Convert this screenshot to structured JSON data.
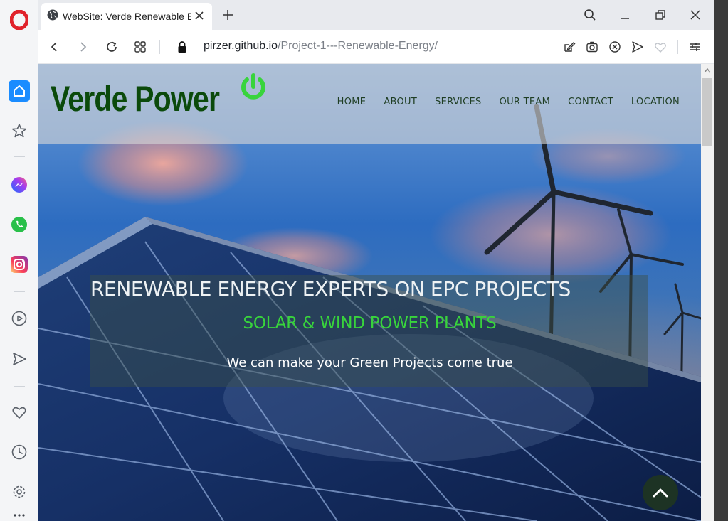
{
  "browser": {
    "tab_title": "WebSite: Verde Renewable Energy",
    "url_host": "pirzer.github.io",
    "url_path": "/Project-1---Renewable-Energy/"
  },
  "sidebar": {
    "items": [
      "opera-logo",
      "home-icon",
      "star-icon",
      "messenger-icon",
      "whatsapp-icon",
      "instagram-icon",
      "player-icon",
      "send-icon",
      "heart-icon",
      "history-icon",
      "settings-icon",
      "more-icon"
    ]
  },
  "site": {
    "logo": "Verde Power",
    "nav": [
      "HOME",
      "ABOUT",
      "SERVICES",
      "OUR TEAM",
      "CONTACT",
      "LOCATION"
    ],
    "headline": "RENEWABLE ENERGY EXPERTS ON EPC PROJECTS",
    "subhead": "SOLAR & WIND POWER PLANTS",
    "tagline": "We can make your Green Projects come true"
  },
  "colors": {
    "logo_green": "#0b4a0b",
    "accent_green": "#38d43c",
    "header_bg": "#d6d6d6",
    "to_top_bg": "#1d3324"
  }
}
